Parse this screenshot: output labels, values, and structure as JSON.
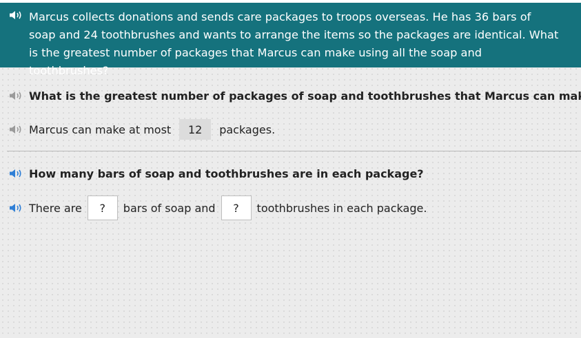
{
  "prompt": {
    "text": "Marcus collects donations and sends care packages to troops overseas. He has 36 bars of soap and 24 toothbrushes and wants to arrange the items so the packages are identical. What is the greatest number of packages that Marcus can make using all the soap and toothbrushes?"
  },
  "part1": {
    "question": "What is the greatest number of packages of soap and toothbrushes that Marcus can make?",
    "answer_prefix": "Marcus can make at most",
    "answer_value": "12",
    "answer_suffix": "packages."
  },
  "part2": {
    "question": "How many bars of soap and toothbrushes are in each package?",
    "prefix": "There are",
    "soap_value": "?",
    "middle": "bars of soap and",
    "toothbrush_value": "?",
    "suffix": "toothbrushes in each package."
  },
  "colors": {
    "banner": "#15727d",
    "speaker_white": "#ffffff",
    "speaker_gray": "#9a9a9a",
    "speaker_blue": "#2f7fd6"
  },
  "icons": {
    "speaker": "speaker-icon"
  }
}
